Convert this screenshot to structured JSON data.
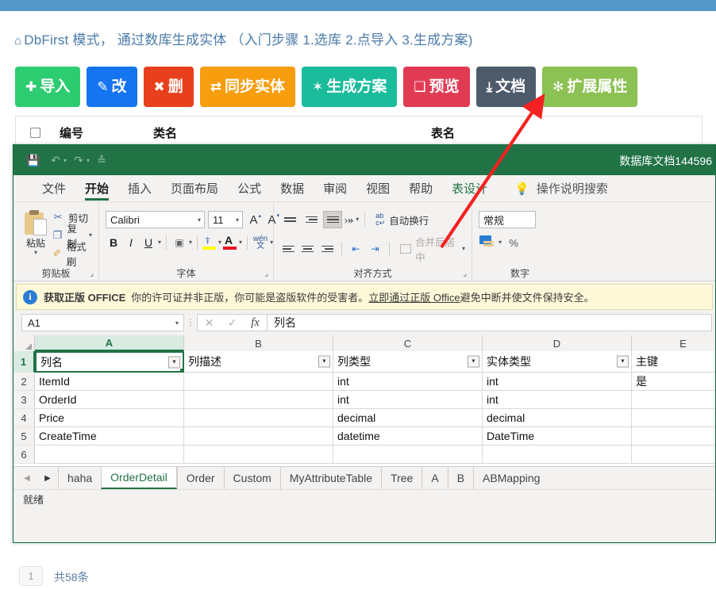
{
  "web": {
    "title": "DbFirst 模式， 通过数库生成实体 （入门步骤 1.选库 2.点导入 3.生成方案)",
    "home_icon": "⌂",
    "buttons": [
      {
        "label": "导入",
        "icon": "✚",
        "color": "#2ecc71"
      },
      {
        "label": "改",
        "icon": "✎",
        "color": "#1574f0"
      },
      {
        "label": "删",
        "icon": "✖",
        "color": "#e8401c"
      },
      {
        "label": "同步实体",
        "icon": "⇄",
        "color": "#f79d0e"
      },
      {
        "label": "生成方案",
        "icon": "✾",
        "color": "#1abc9c"
      },
      {
        "label": "预览",
        "icon": "❐",
        "color": "#e13b54"
      },
      {
        "label": "文档",
        "icon": "⤓",
        "color": "#4d5b6a"
      },
      {
        "label": "扩展属性",
        "icon": "❋",
        "color": "#8cc153"
      }
    ],
    "table_headers": [
      "编号",
      "类名",
      "表名"
    ],
    "footer": {
      "page": "1",
      "total": "共58条"
    }
  },
  "excel": {
    "document_title": "数据库文档144596",
    "quick_access": [
      "save-icon",
      "undo-icon",
      "redo-icon",
      "customize-icon"
    ],
    "tabs": [
      {
        "label": "文件",
        "state": "normal"
      },
      {
        "label": "开始",
        "state": "active"
      },
      {
        "label": "插入",
        "state": "normal"
      },
      {
        "label": "页面布局",
        "state": "normal"
      },
      {
        "label": "公式",
        "state": "normal"
      },
      {
        "label": "数据",
        "state": "normal"
      },
      {
        "label": "审阅",
        "state": "normal"
      },
      {
        "label": "视图",
        "state": "normal"
      },
      {
        "label": "帮助",
        "state": "normal"
      },
      {
        "label": "表设计",
        "state": "contextual"
      }
    ],
    "tell_me": "操作说明搜索",
    "ribbon": {
      "clipboard": {
        "group_label": "剪贴板",
        "paste": "粘贴",
        "commands": [
          {
            "label": "剪切",
            "icon": "scissors-icon"
          },
          {
            "label": "复制",
            "icon": "copy-icon"
          },
          {
            "label": "格式刷",
            "icon": "format-painter-icon"
          }
        ]
      },
      "font": {
        "group_label": "字体",
        "font_name": "Calibri",
        "font_size": "11",
        "bold": "B",
        "italic": "I",
        "underline": "U",
        "grow_font": "A",
        "shrink_font": "A",
        "phonetic": "wén 文"
      },
      "alignment": {
        "group_label": "对齐方式",
        "wrap_text": "自动换行",
        "merge_center": "合并后居中"
      },
      "number": {
        "group_label": "数字",
        "format": "常规"
      }
    },
    "banner": {
      "strong": "获取正版 OFFICE",
      "text": "你的许可证并非正版，你可能是盗版软件的受害者。",
      "link": "立即通过正版 Office",
      "tail": "避免中断并使文件保持安全。"
    },
    "formula_bar": {
      "name_box": "A1",
      "cancel_icon": "✕",
      "enter_icon": "✓",
      "fx_icon": "fx",
      "value": "列名"
    },
    "grid": {
      "columns": [
        "A",
        "B",
        "C",
        "D",
        "E"
      ],
      "row_numbers": [
        "1",
        "2",
        "3",
        "4",
        "5",
        "6"
      ],
      "active_cell": "A1",
      "rows": [
        [
          "列名",
          "列描述",
          "列类型",
          "实体类型",
          "主键"
        ],
        [
          "ItemId",
          "",
          "int",
          "int",
          "是"
        ],
        [
          "OrderId",
          "",
          "int",
          "int",
          ""
        ],
        [
          "Price",
          "",
          "decimal",
          "decimal",
          ""
        ],
        [
          "CreateTime",
          "",
          "datetime",
          "DateTime",
          ""
        ],
        [
          "",
          "",
          "",
          "",
          ""
        ]
      ]
    },
    "sheets": {
      "items": [
        "haha",
        "OrderDetail",
        "Order",
        "Custom",
        "MyAttributeTable",
        "Tree",
        "A",
        "B",
        "ABMapping"
      ],
      "active": "OrderDetail"
    },
    "status": "就绪"
  }
}
